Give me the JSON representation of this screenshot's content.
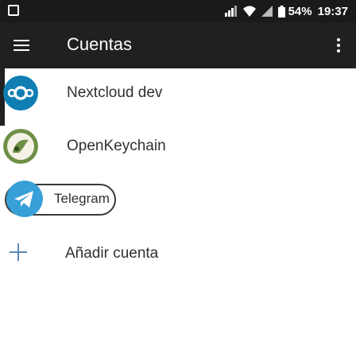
{
  "status_bar": {
    "battery_percent": "54%",
    "time": "19:37",
    "icons": [
      "notification-icon",
      "signal-icon",
      "wifi-icon",
      "battery-icon"
    ]
  },
  "app_bar": {
    "title": "Cuentas",
    "icons": [
      "menu-icon",
      "more-vert-icon"
    ]
  },
  "accounts": [
    {
      "label": "Nextcloud dev",
      "icon": "nextcloud-icon",
      "color": "#0f7fb3"
    },
    {
      "label": "OpenKeychain",
      "icon": "openkeychain-icon",
      "color": "#6e8f45"
    },
    {
      "label": "Telegram",
      "icon": "telegram-icon",
      "color": "#37a0d8"
    }
  ],
  "add_account": {
    "label": "Añadir cuenta",
    "icon": "plus-icon",
    "color": "#5b87b8"
  },
  "colors": {
    "status_bar_bg": "#1a1a1a",
    "app_bar_bg": "#202020",
    "text": "#303030"
  }
}
